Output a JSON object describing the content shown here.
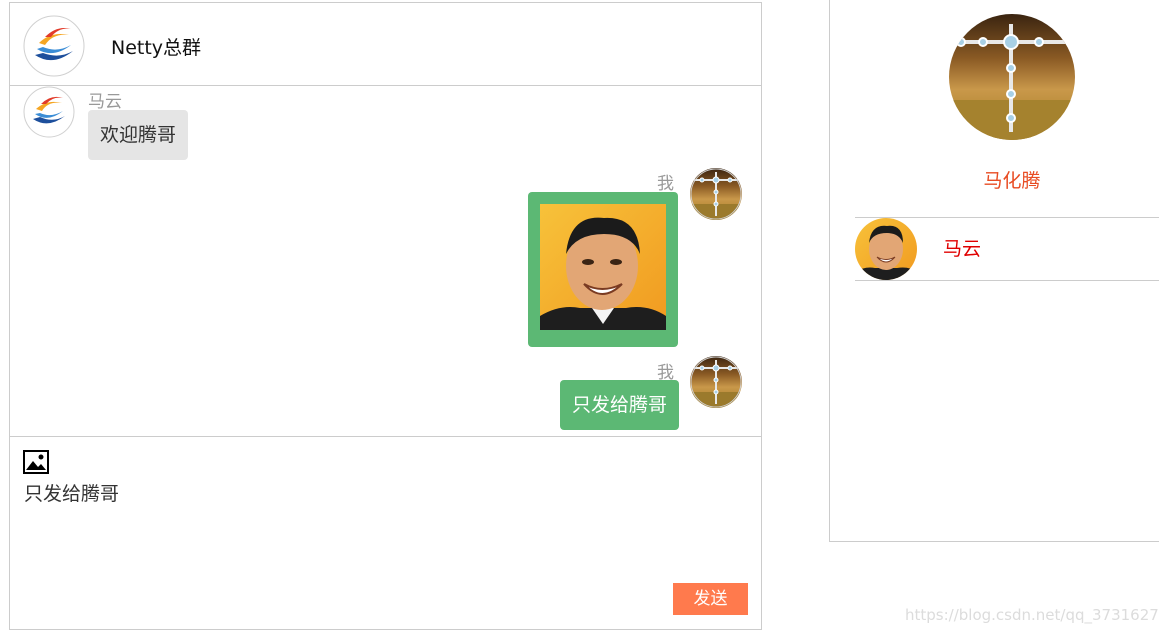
{
  "chat": {
    "group_name": "Netty总群",
    "messages": [
      {
        "sender": "马云",
        "side": "left",
        "text": "欢迎腾哥"
      },
      {
        "sender": "我",
        "side": "right",
        "type": "image",
        "image_icon": "photo-of-ma-yun"
      },
      {
        "sender": "我",
        "side": "right",
        "text": "只发给腾哥"
      }
    ]
  },
  "composer": {
    "image_icon": "image-icon",
    "text": "只发给腾哥",
    "send_label": "发送"
  },
  "user_panel": {
    "profile_name": "马化腾",
    "users": [
      {
        "name": "马云"
      }
    ]
  },
  "watermark": "https://blog.csdn.net/qq_37316272",
  "colors": {
    "my_bubble": "#5cb874",
    "other_bubble": "#e5e5e5",
    "send_button": "#ff7a4d",
    "profile_name": "#e84c23",
    "user_name": "#e00000"
  }
}
